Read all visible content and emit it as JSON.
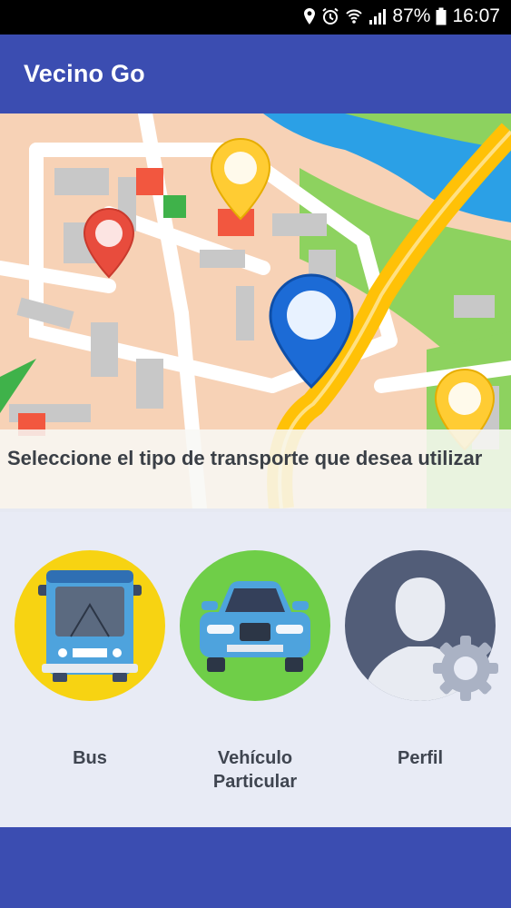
{
  "status": {
    "battery": "87%",
    "time": "16:07"
  },
  "app": {
    "title": "Vecino Go"
  },
  "banner": {
    "text": "Seleccione el tipo de transporte que desea utilizar"
  },
  "options": [
    {
      "label": "Bus",
      "icon": "bus-icon",
      "color": "#f7d312"
    },
    {
      "label": "Vehículo Particular",
      "icon": "car-icon",
      "color": "#6fce48"
    },
    {
      "label": "Perfil",
      "icon": "profile-icon",
      "color": "#525d78"
    }
  ],
  "colors": {
    "primary": "#3b4db1"
  }
}
